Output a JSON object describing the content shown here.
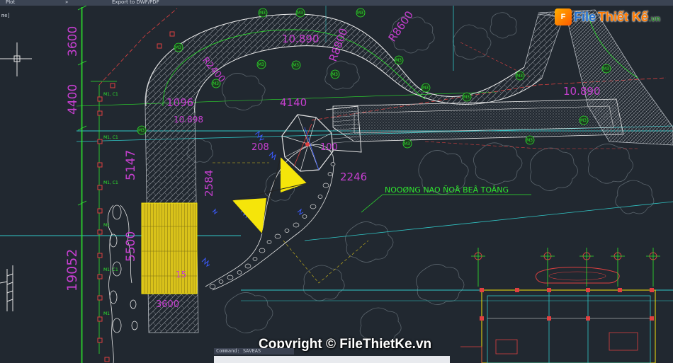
{
  "menu": {
    "plot": "Plot",
    "export": "Export to DWF/PDF",
    "arrow": "»"
  },
  "viewport": {
    "label": "me]"
  },
  "dims_vertical": {
    "d3600": "3600",
    "d4400": "4400",
    "d5147": "5147",
    "d19052": "19052",
    "d5500": "5500",
    "d2584": "2584"
  },
  "dims_plan": {
    "d10890a": "10.890",
    "d10890b": "10.890",
    "d10898": "10.898",
    "d4140": "4140",
    "d1096": "1096",
    "d2246": "2246",
    "dr8800": "R8800",
    "dr8600": "R8600",
    "dr2400": "R2400",
    "d3600b": "3600",
    "d208": "208",
    "d100": "100",
    "d15": "15"
  },
  "annotation": {
    "label": "NOOØNG NAO ÑOÅ BEÂ TOÂNG"
  },
  "tags": {
    "m3": "M3",
    "m1c1": "M1, C1",
    "m1": "M1",
    "c1": "C1"
  },
  "logo": {
    "file": "File",
    "thiet": "Thiết Kế",
    "vn": ".vn"
  },
  "watermark": {
    "text": "Copyright © FileThietKe.vn"
  },
  "command": {
    "title": "Command:",
    "value": "SAVEAS",
    "input": ""
  },
  "colors": {
    "background": "#212830",
    "green": "#2ee62e",
    "magenta": "#c63fd0",
    "cyan": "#31c7c7",
    "yellow": "#f5e50a",
    "red": "#e04040",
    "white": "#d9d9d9"
  }
}
